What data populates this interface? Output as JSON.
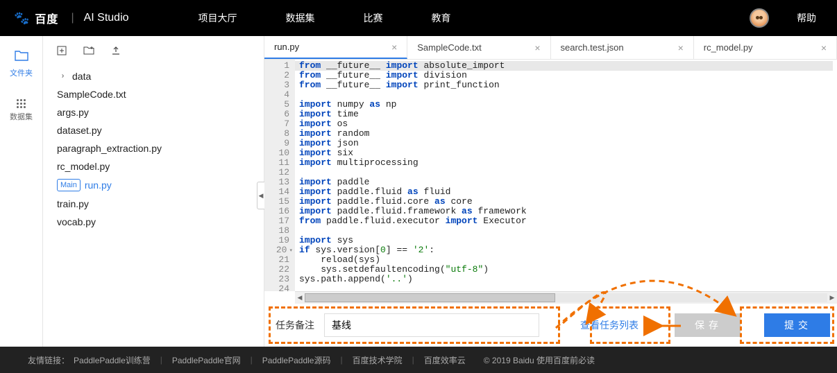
{
  "header": {
    "logo_brand": "百度",
    "logo_product": "AI Studio",
    "nav": [
      "项目大厅",
      "数据集",
      "比赛",
      "教育"
    ],
    "help": "帮助"
  },
  "left_rail": {
    "items": [
      {
        "icon_name": "folder-icon",
        "label": "文件夹"
      },
      {
        "icon_name": "dataset-icon",
        "label": "数据集"
      }
    ]
  },
  "file_panel": {
    "folder": "data",
    "files": [
      "SampleCode.txt",
      "args.py",
      "dataset.py",
      "paragraph_extraction.py",
      "rc_model.py",
      "run.py",
      "train.py",
      "vocab.py"
    ],
    "active_file": "run.py",
    "main_badge": "Main"
  },
  "tabs": [
    {
      "label": "run.py",
      "active": true
    },
    {
      "label": "SampleCode.txt",
      "active": false
    },
    {
      "label": "search.test.json",
      "active": false
    },
    {
      "label": "rc_model.py",
      "active": false
    }
  ],
  "code_lines": [
    {
      "n": 1,
      "tokens": [
        [
          "kw-blue",
          "from"
        ],
        [
          "",
          " __future__ "
        ],
        [
          "kw-blue",
          "import"
        ],
        [
          "",
          " absolute_import"
        ]
      ]
    },
    {
      "n": 2,
      "tokens": [
        [
          "kw-blue",
          "from"
        ],
        [
          "",
          " __future__ "
        ],
        [
          "kw-blue",
          "import"
        ],
        [
          "",
          " division"
        ]
      ]
    },
    {
      "n": 3,
      "tokens": [
        [
          "kw-blue",
          "from"
        ],
        [
          "",
          " __future__ "
        ],
        [
          "kw-blue",
          "import"
        ],
        [
          "",
          " print_function"
        ]
      ]
    },
    {
      "n": 4,
      "tokens": []
    },
    {
      "n": 5,
      "tokens": [
        [
          "kw-blue",
          "import"
        ],
        [
          "",
          " numpy "
        ],
        [
          "kw-blue",
          "as"
        ],
        [
          "",
          " np"
        ]
      ]
    },
    {
      "n": 6,
      "tokens": [
        [
          "kw-blue",
          "import"
        ],
        [
          "",
          " time"
        ]
      ]
    },
    {
      "n": 7,
      "tokens": [
        [
          "kw-blue",
          "import"
        ],
        [
          "",
          " os"
        ]
      ]
    },
    {
      "n": 8,
      "tokens": [
        [
          "kw-blue",
          "import"
        ],
        [
          "",
          " random"
        ]
      ]
    },
    {
      "n": 9,
      "tokens": [
        [
          "kw-blue",
          "import"
        ],
        [
          "",
          " json"
        ]
      ]
    },
    {
      "n": 10,
      "tokens": [
        [
          "kw-blue",
          "import"
        ],
        [
          "",
          " six"
        ]
      ]
    },
    {
      "n": 11,
      "tokens": [
        [
          "kw-blue",
          "import"
        ],
        [
          "",
          " multiprocessing"
        ]
      ]
    },
    {
      "n": 12,
      "tokens": []
    },
    {
      "n": 13,
      "tokens": [
        [
          "kw-blue",
          "import"
        ],
        [
          "",
          " paddle"
        ]
      ]
    },
    {
      "n": 14,
      "tokens": [
        [
          "kw-blue",
          "import"
        ],
        [
          "",
          " paddle.fluid "
        ],
        [
          "kw-blue",
          "as"
        ],
        [
          "",
          " fluid"
        ]
      ]
    },
    {
      "n": 15,
      "tokens": [
        [
          "kw-blue",
          "import"
        ],
        [
          "",
          " paddle.fluid.core "
        ],
        [
          "kw-blue",
          "as"
        ],
        [
          "",
          " core"
        ]
      ]
    },
    {
      "n": 16,
      "tokens": [
        [
          "kw-blue",
          "import"
        ],
        [
          "",
          " paddle.fluid.framework "
        ],
        [
          "kw-blue",
          "as"
        ],
        [
          "",
          " framework"
        ]
      ]
    },
    {
      "n": 17,
      "tokens": [
        [
          "kw-blue",
          "from"
        ],
        [
          "",
          " paddle.fluid.executor "
        ],
        [
          "kw-blue",
          "import"
        ],
        [
          "",
          " Executor"
        ]
      ]
    },
    {
      "n": 18,
      "tokens": []
    },
    {
      "n": 19,
      "tokens": [
        [
          "kw-blue",
          "import"
        ],
        [
          "",
          " sys"
        ]
      ]
    },
    {
      "n": 20,
      "fold": true,
      "tokens": [
        [
          "kw-blue",
          "if"
        ],
        [
          "",
          " sys.version["
        ],
        [
          "kw-num",
          "0"
        ],
        [
          "",
          "] == "
        ],
        [
          "kw-str",
          "'2'"
        ],
        [
          "",
          ":"
        ]
      ]
    },
    {
      "n": 21,
      "tokens": [
        [
          "",
          "    reload(sys)"
        ]
      ]
    },
    {
      "n": 22,
      "tokens": [
        [
          "",
          "    sys.setdefaultencoding("
        ],
        [
          "kw-str",
          "\"utf-8\""
        ],
        [
          "",
          ")"
        ]
      ]
    },
    {
      "n": 23,
      "tokens": [
        [
          "",
          "sys.path.append("
        ],
        [
          "kw-str",
          "'..'"
        ],
        [
          "",
          ")"
        ]
      ]
    },
    {
      "n": 24,
      "tokens": []
    }
  ],
  "bottom": {
    "task_label": "任务备注",
    "task_value": "基线",
    "view_link": "查看任务列表",
    "save_label": "保存",
    "submit_label": "提交"
  },
  "footer": {
    "prefix": "友情链接：",
    "links": [
      "PaddlePaddle训练营",
      "PaddlePaddle官网",
      "PaddlePaddle源码",
      "百度技术学院",
      "百度效率云"
    ],
    "copyright": "© 2019 Baidu 使用百度前必读"
  }
}
